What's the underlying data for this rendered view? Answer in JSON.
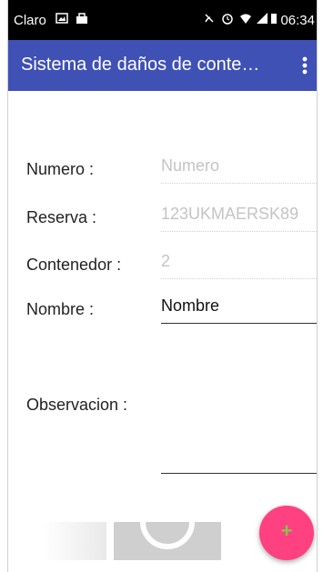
{
  "status_bar": {
    "carrier": "Claro",
    "time": "06:34"
  },
  "app_bar": {
    "title": "Sistema de daños de conte…"
  },
  "form": {
    "numero_label": "Numero :",
    "numero_placeholder": "Numero",
    "reserva_label": "Reserva :",
    "reserva_value": "123UKMAERSK89",
    "contenedor_label": "Contenedor :",
    "contenedor_value": "2",
    "nombre_label": "Nombre :",
    "nombre_value": "Nombre",
    "observacion_label": "Observacion :"
  },
  "fab": {
    "icon": "+"
  },
  "colors": {
    "status_bar": "#000000",
    "app_bar": "#3f51b5",
    "fab": "#ff4081",
    "fab_icon": "#8bc34a",
    "disabled_text": "#c4c4c4"
  }
}
